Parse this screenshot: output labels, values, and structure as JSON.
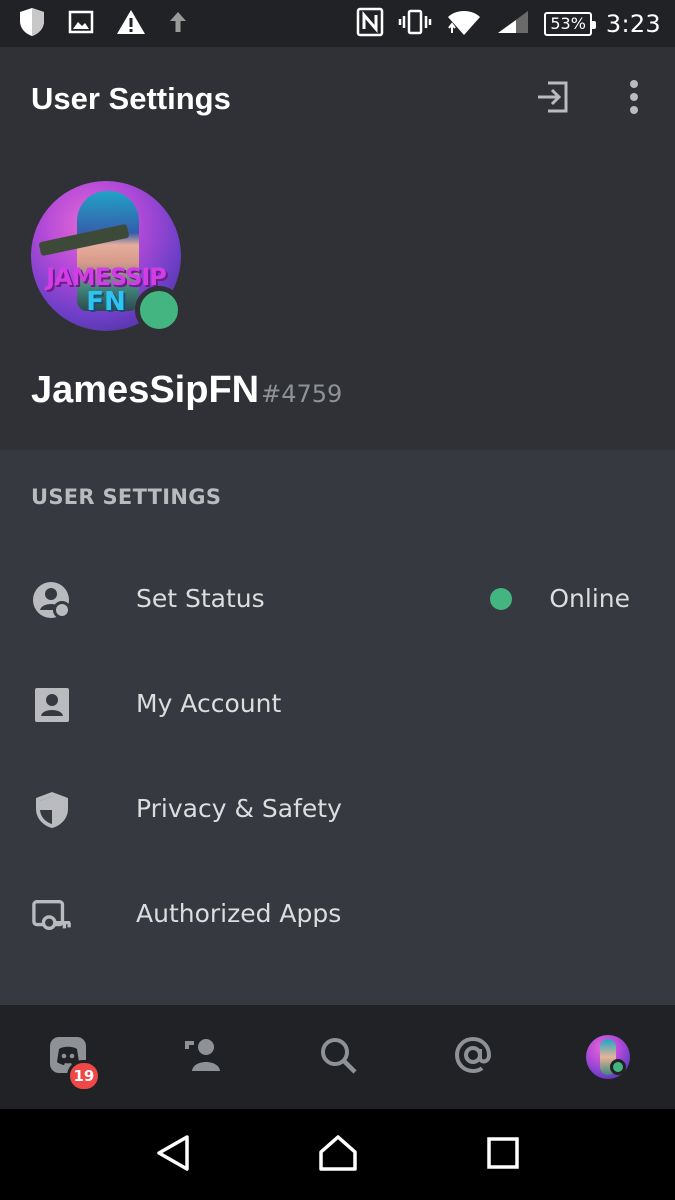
{
  "status_bar": {
    "battery": "53%",
    "time": "3:23",
    "icons": [
      "shield-icon",
      "image-icon",
      "warning-icon",
      "upload-arrow-icon",
      "nfc-icon",
      "vibrate-icon",
      "wifi-icon",
      "signal-icon",
      "battery-icon"
    ]
  },
  "header": {
    "title": "User Settings",
    "username": "JamesSipFN",
    "discriminator": "#4759",
    "avatar_text_line1": "JAMESSIP",
    "avatar_text_line2": "FN",
    "presence_color": "#43b581"
  },
  "settings": {
    "section_label": "USER SETTINGS",
    "items": [
      {
        "label": "Set Status",
        "value": "Online",
        "icon": "status-icon"
      },
      {
        "label": "My Account",
        "icon": "account-icon"
      },
      {
        "label": "Privacy & Safety",
        "icon": "shield-icon"
      },
      {
        "label": "Authorized Apps",
        "icon": "authorized-apps-icon"
      }
    ]
  },
  "tabbar": {
    "home_badge": "19",
    "tabs": [
      "home-tab",
      "friends-tab",
      "search-tab",
      "mentions-tab",
      "profile-tab"
    ]
  },
  "colors": {
    "background": "#36393f",
    "header_bg": "#2f3136",
    "bar_bg": "#202225",
    "online": "#43b581",
    "badge": "#f04747"
  }
}
